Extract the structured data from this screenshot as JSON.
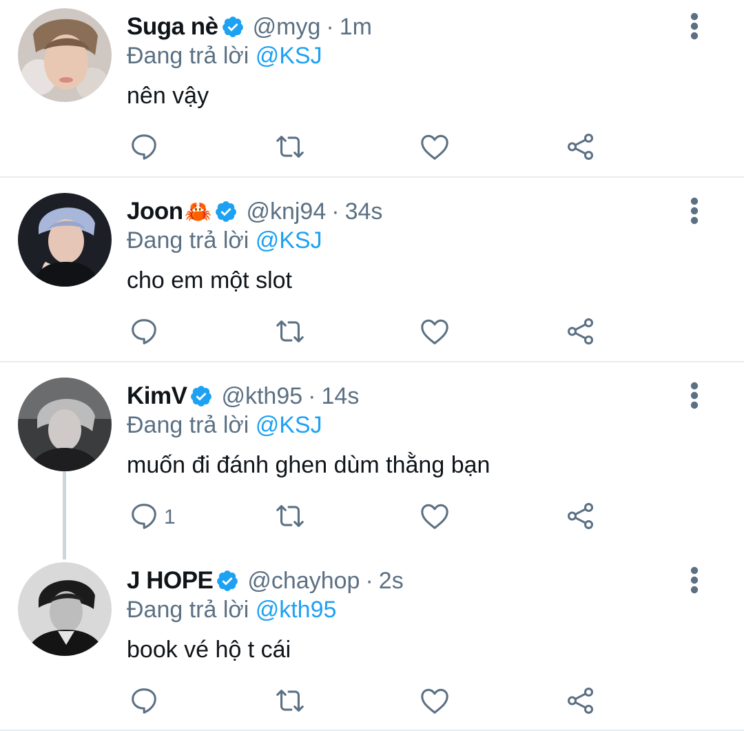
{
  "colors": {
    "link": "#1da1f2",
    "secondary_text": "#5b7083",
    "primary_text": "#0f1419",
    "divider": "#e6ecf0",
    "thread_line": "#ccd6dd"
  },
  "tweets": [
    {
      "name": "Suga nè",
      "emoji": "",
      "verified": true,
      "handle": "@myg",
      "separator": "·",
      "time": "1m",
      "reply_prefix": "Đang trả lời",
      "reply_to": "@KSJ",
      "text": "nên vậy",
      "reply_count": ""
    },
    {
      "name": "Joon",
      "emoji": "🦀",
      "verified": true,
      "handle": "@knj94",
      "separator": "·",
      "time": "34s",
      "reply_prefix": "Đang trả lời",
      "reply_to": "@KSJ",
      "text": "cho em một slot",
      "reply_count": ""
    },
    {
      "name": "KimV",
      "emoji": "",
      "verified": true,
      "handle": "@kth95",
      "separator": "·",
      "time": "14s",
      "reply_prefix": "Đang trả lời",
      "reply_to": "@KSJ",
      "text": "muốn đi đánh ghen dùm thằng bạn",
      "reply_count": "1"
    },
    {
      "name": "J HOPE",
      "emoji": "",
      "verified": true,
      "handle": "@chayhop",
      "separator": "·",
      "time": "2s",
      "reply_prefix": "Đang trả lời",
      "reply_to": "@kth95",
      "text": "book vé hộ t cái",
      "reply_count": ""
    }
  ],
  "icons": {
    "reply": "reply-icon",
    "retweet": "retweet-icon",
    "like": "heart-icon",
    "share": "share-icon",
    "more": "more-vertical-icon",
    "verified": "verified-badge-icon"
  }
}
